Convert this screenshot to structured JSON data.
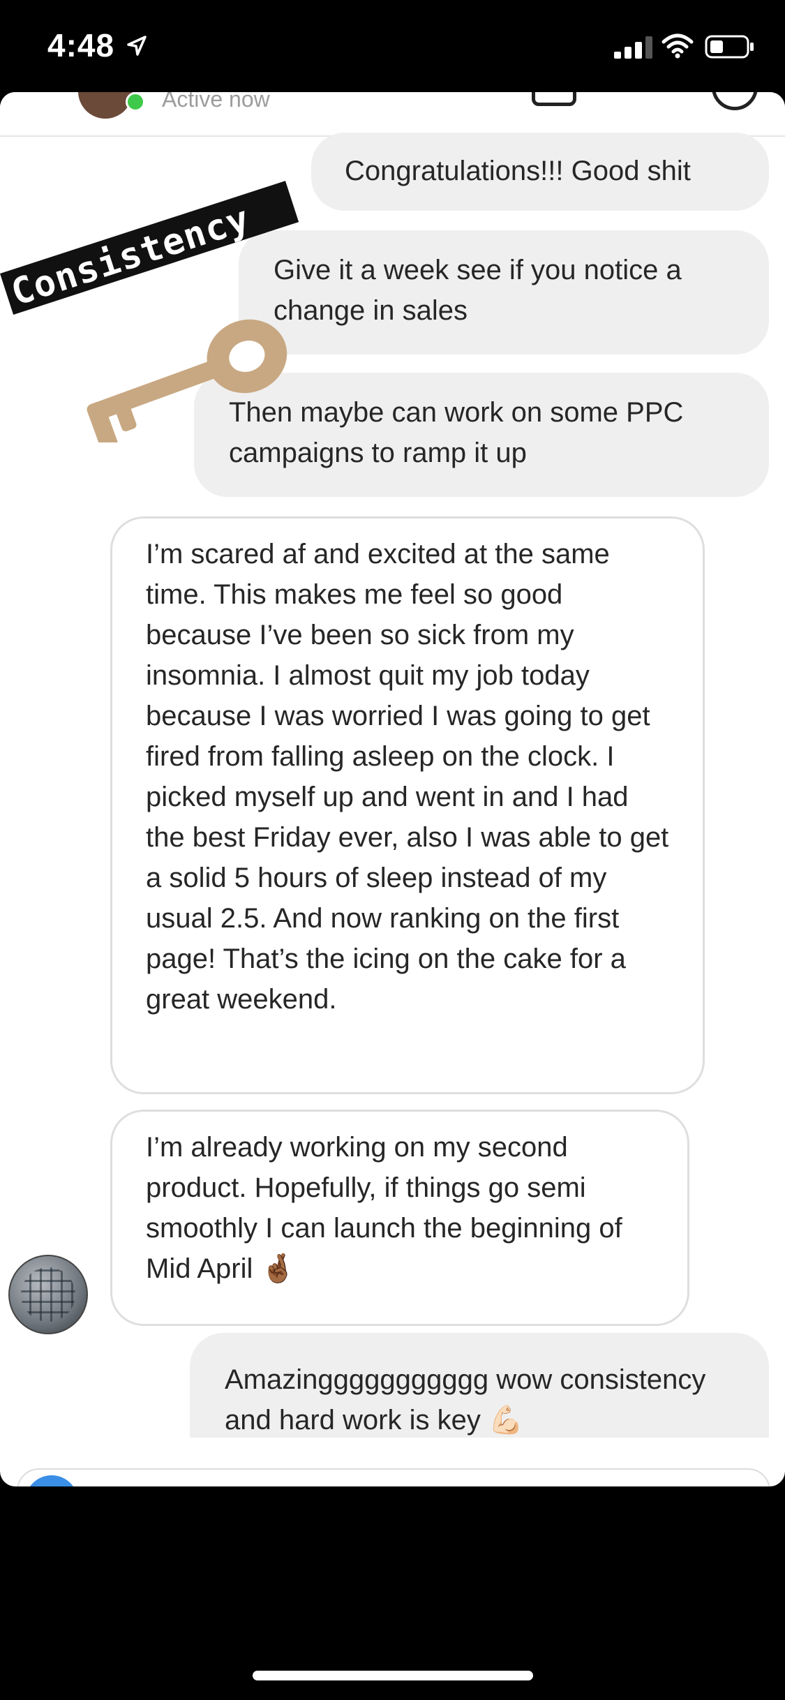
{
  "status_bar": {
    "time": "4:48",
    "icons": [
      "location-arrow-icon",
      "signal-icon",
      "wifi-icon",
      "battery-icon"
    ]
  },
  "header": {
    "status_text": "Active now",
    "online_color": "#3fc94a"
  },
  "stickers": {
    "consistency_text": "Consistency",
    "key_color": "#c8a882"
  },
  "messages": [
    {
      "direction": "sent",
      "text": "Congratulations!!! Good shit"
    },
    {
      "direction": "sent",
      "text": "Give it a week see if you notice a change in sales"
    },
    {
      "direction": "sent",
      "text": "Then maybe can work on some PPC campaigns to ramp it up"
    },
    {
      "direction": "received",
      "text": "I’m scared af and excited at the same time. This makes me feel so good because I’ve been so sick from my insomnia. I almost quit my job today because I was worried I was going to get fired from falling asleep on the clock. I picked myself up and went in and I had the best Friday ever, also I was able to get a solid 5 hours of sleep instead of my usual 2.5. And now ranking on the first page! That’s the icing on the cake for a great weekend."
    },
    {
      "direction": "received",
      "text": "I’m already working on my second product. Hopefully, if things go semi smoothly I can launch the beginning of Mid April 🤞🏾"
    },
    {
      "direction": "sent",
      "text": "Amazinggggggggggg wow consistency and hard work is key 💪🏻"
    }
  ]
}
